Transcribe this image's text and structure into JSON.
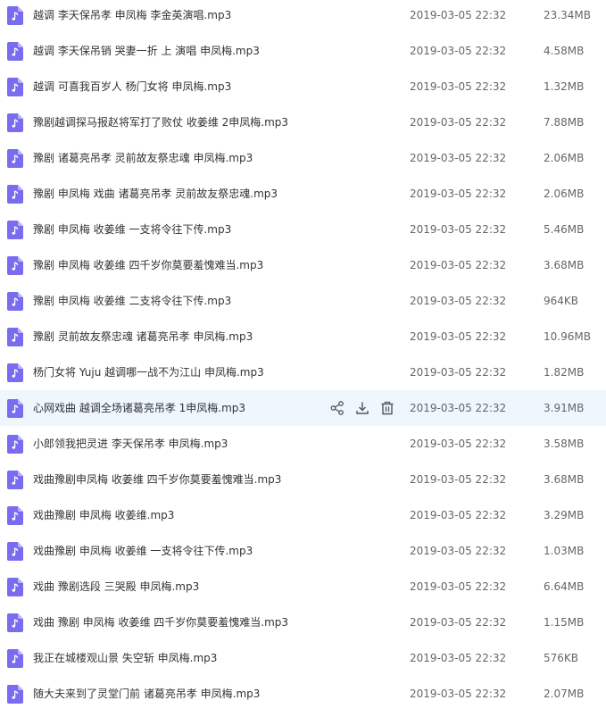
{
  "colors": {
    "icon_bg": "#7a6cf0",
    "icon_fold": "#b8b0f8",
    "selected_row_bg": "#eef6fe",
    "action_icon": "#555555"
  },
  "icons": {
    "file": "audio-file-icon",
    "share": "share-icon",
    "download": "download-icon",
    "delete": "trash-icon"
  },
  "files": [
    {
      "name": "越调 李天保吊孝 申凤梅 李金英演唱.mp3",
      "date": "2019-03-05 22:32",
      "size": "23.34MB",
      "selected": false
    },
    {
      "name": "越调 李天保吊销 哭妻一折 上 演唱 申凤梅.mp3",
      "date": "2019-03-05 22:32",
      "size": "4.58MB",
      "selected": false
    },
    {
      "name": "越调 可喜我百岁人 杨门女将 申凤梅.mp3",
      "date": "2019-03-05 22:32",
      "size": "1.32MB",
      "selected": false
    },
    {
      "name": "豫剧越调探马报赵将军打了败仗 收姜维 2申凤梅.mp3",
      "date": "2019-03-05 22:32",
      "size": "7.88MB",
      "selected": false
    },
    {
      "name": "豫剧 诸葛亮吊孝 灵前故友祭忠魂 申凤梅.mp3",
      "date": "2019-03-05 22:32",
      "size": "2.06MB",
      "selected": false
    },
    {
      "name": "豫剧 申凤梅 戏曲 诸葛亮吊孝 灵前故友祭忠魂.mp3",
      "date": "2019-03-05 22:32",
      "size": "2.06MB",
      "selected": false
    },
    {
      "name": "豫剧 申凤梅 收姜维 一支将令往下传.mp3",
      "date": "2019-03-05 22:32",
      "size": "5.46MB",
      "selected": false
    },
    {
      "name": "豫剧 申凤梅 收姜维 四千岁你莫要羞愧难当.mp3",
      "date": "2019-03-05 22:32",
      "size": "3.68MB",
      "selected": false
    },
    {
      "name": "豫剧 申凤梅 收姜维 二支将令往下传.mp3",
      "date": "2019-03-05 22:32",
      "size": "964KB",
      "selected": false
    },
    {
      "name": "豫剧 灵前故友祭忠魂 诸葛亮吊孝 申凤梅.mp3",
      "date": "2019-03-05 22:32",
      "size": "10.96MB",
      "selected": false
    },
    {
      "name": "杨门女将 Yuju 越调哪一战不为江山 申凤梅.mp3",
      "date": "2019-03-05 22:32",
      "size": "1.82MB",
      "selected": false
    },
    {
      "name": "心网戏曲 越调全场诸葛亮吊孝 1申凤梅.mp3",
      "date": "2019-03-05 22:32",
      "size": "3.91MB",
      "selected": true
    },
    {
      "name": "小郎领我把灵进 李天保吊孝 申凤梅.mp3",
      "date": "2019-03-05 22:32",
      "size": "3.58MB",
      "selected": false
    },
    {
      "name": "戏曲豫剧申凤梅 收姜维 四千岁你莫要羞愧难当.mp3",
      "date": "2019-03-05 22:32",
      "size": "3.68MB",
      "selected": false
    },
    {
      "name": "戏曲豫剧 申凤梅 收姜维.mp3",
      "date": "2019-03-05 22:32",
      "size": "3.29MB",
      "selected": false
    },
    {
      "name": "戏曲豫剧 申凤梅 收姜维 一支将令往下传.mp3",
      "date": "2019-03-05 22:32",
      "size": "1.03MB",
      "selected": false
    },
    {
      "name": "戏曲 豫剧选段 三哭殿 申凤梅.mp3",
      "date": "2019-03-05 22:32",
      "size": "6.64MB",
      "selected": false
    },
    {
      "name": "戏曲 豫剧 申凤梅 收姜维 四千岁你莫要羞愧难当.mp3",
      "date": "2019-03-05 22:32",
      "size": "1.15MB",
      "selected": false
    },
    {
      "name": "我正在城楼观山景 失空斩 申凤梅.mp3",
      "date": "2019-03-05 22:32",
      "size": "576KB",
      "selected": false
    },
    {
      "name": "随大夫来到了灵堂门前 诸葛亮吊孝 申凤梅.mp3",
      "date": "2019-03-05 22:32",
      "size": "2.07MB",
      "selected": false
    }
  ]
}
